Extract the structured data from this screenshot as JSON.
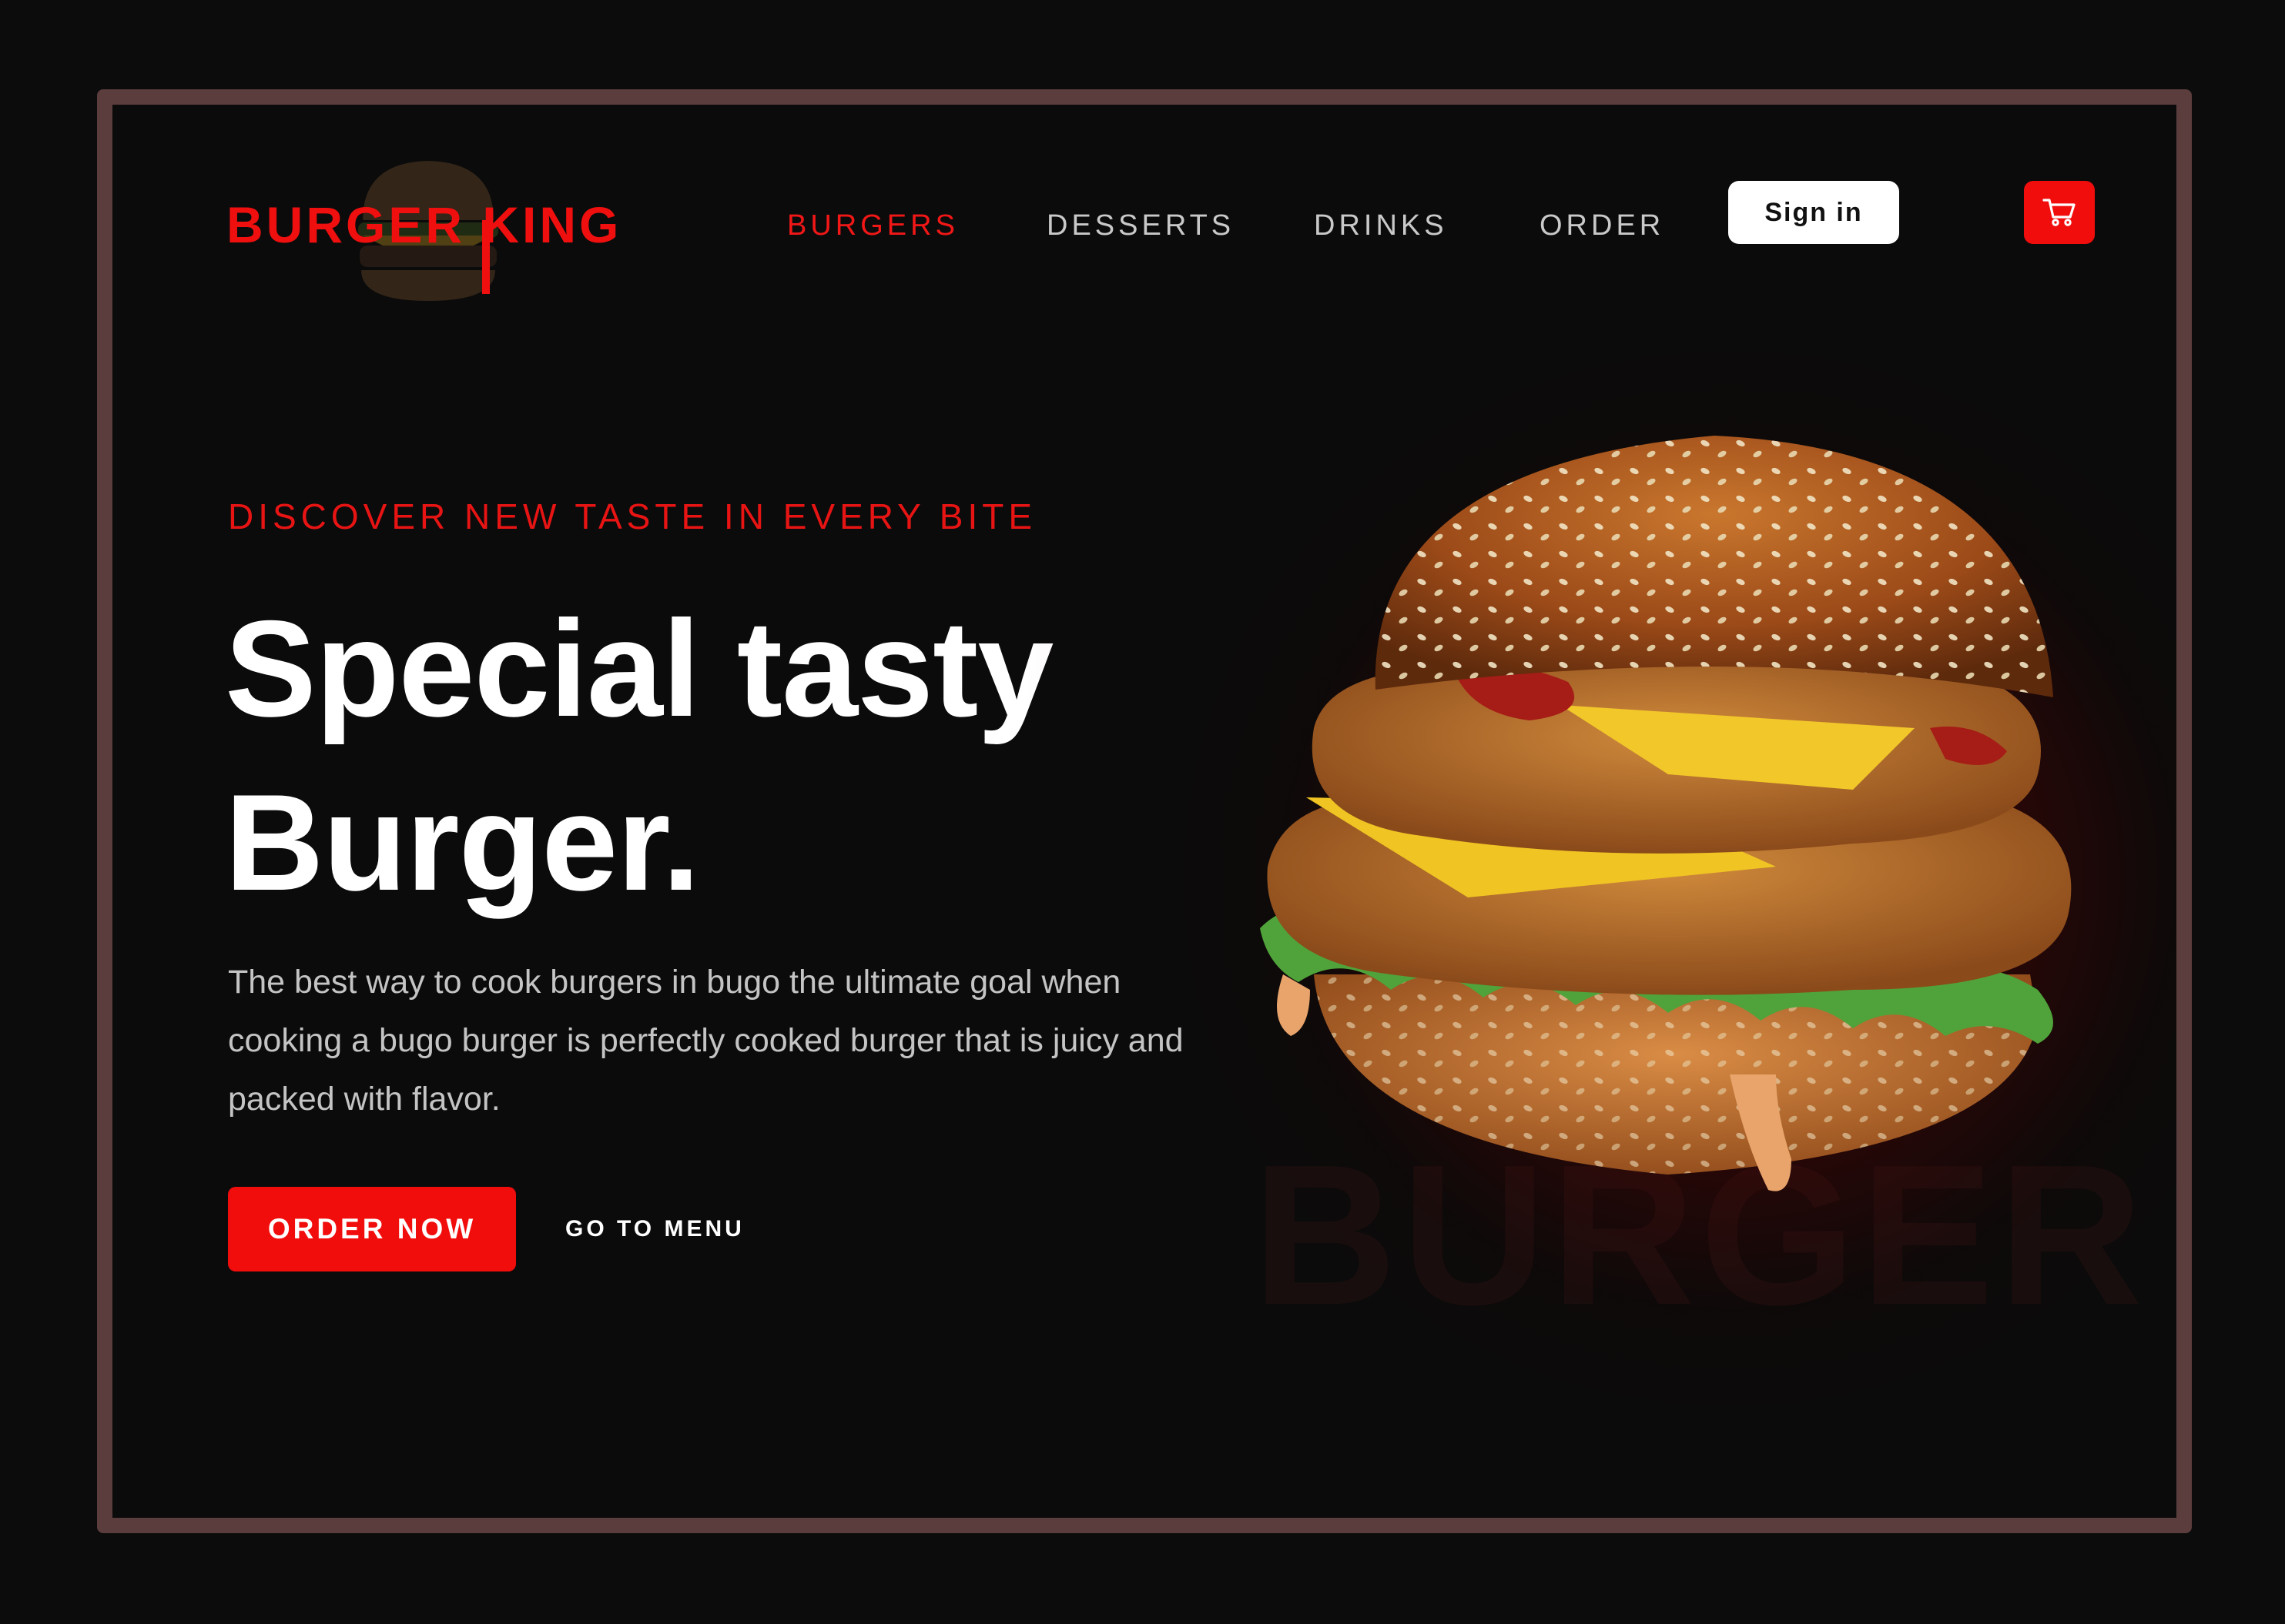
{
  "brand": {
    "name": "BURGER KING",
    "accent": "#f20d0d"
  },
  "nav": {
    "items": [
      {
        "label": "BURGERS",
        "active": true
      },
      {
        "label": "DESSERTS",
        "active": false
      },
      {
        "label": "DRINKS",
        "active": false
      },
      {
        "label": "ORDER",
        "active": false
      }
    ],
    "signin_label": "Sign in",
    "cart_icon": "cart-icon"
  },
  "hero": {
    "eyebrow": "DISCOVER NEW TASTE IN EVERY BITE",
    "headline_line1": "Special tasty",
    "headline_line2": "Burger.",
    "description": "The best way to cook burgers in bugo the ultimate goal when cooking a bugo burger is perfectly cooked burger that is juicy and packed with flavor.",
    "primary_cta": "ORDER NOW",
    "secondary_cta": "GO TO MENU",
    "watermark": "BURGER",
    "image_icon": "burger-image"
  },
  "colors": {
    "background": "#0b0b0b",
    "frame": "#5c3d3d",
    "text": "#ffffff",
    "muted": "#c4c4c4"
  }
}
